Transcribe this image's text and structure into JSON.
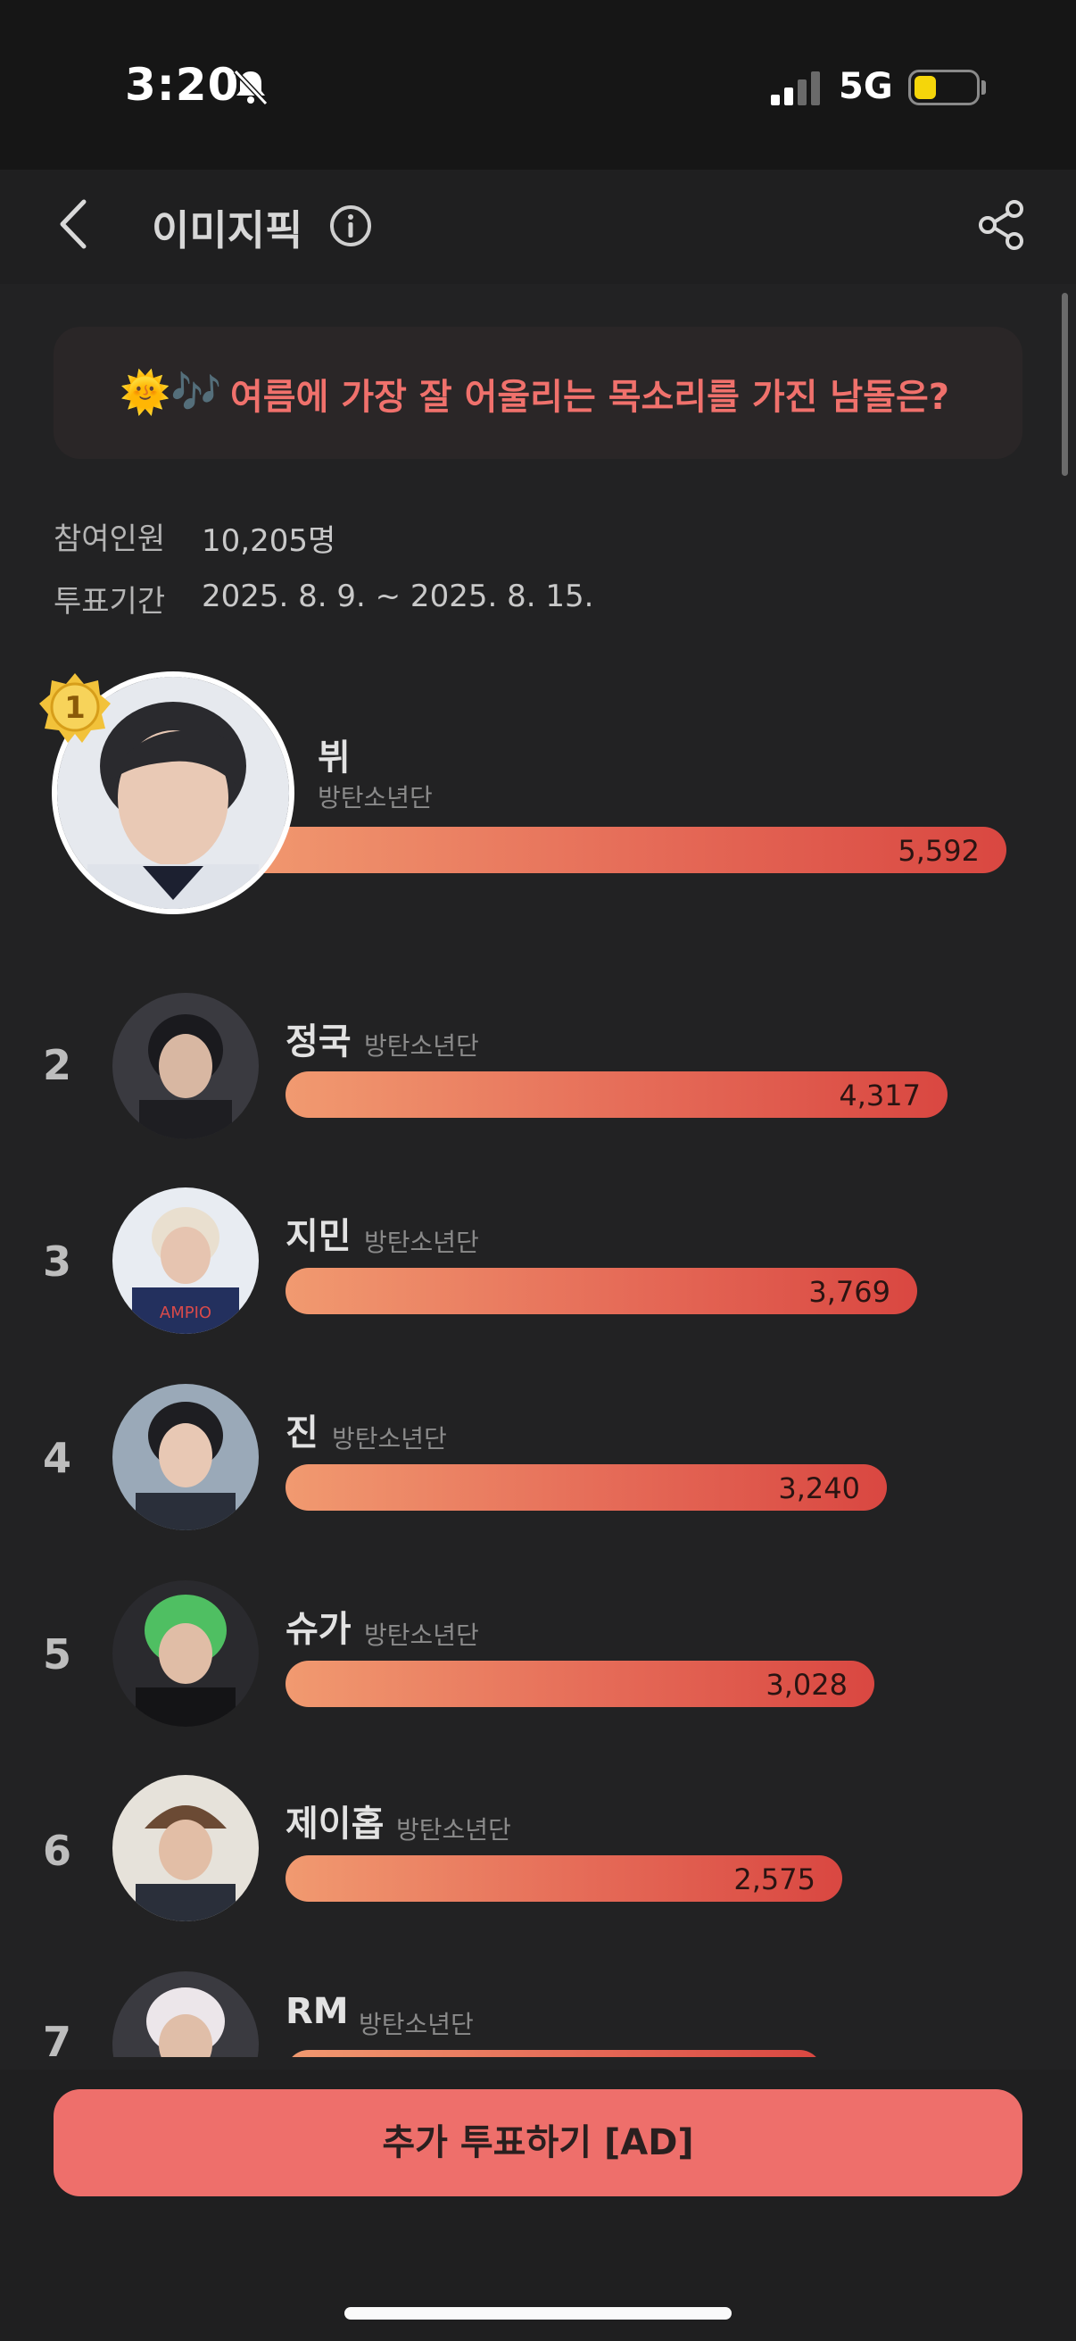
{
  "status_bar": {
    "time": "3:20",
    "network": "5G",
    "battery_level": 0.35
  },
  "nav": {
    "title": "이미지픽",
    "icons": [
      "chevron-left-icon",
      "info-icon",
      "share-icon"
    ]
  },
  "question": {
    "emoji": "🌞🎶",
    "text": "여름에 가장 잘 어울리는 목소리를 가진 남돌은?"
  },
  "meta": {
    "participants_label": "참여인원",
    "participants_value": "10,205명",
    "period_label": "투표기간",
    "period_value": "2025. 8. 9. ~ 2025. 8. 15."
  },
  "rankings": [
    {
      "rank": "1",
      "name": "뷔",
      "group": "방탄소년단",
      "votes": "5,592",
      "avatar_color": "#9ea8b6"
    },
    {
      "rank": "2",
      "name": "정국",
      "group": "방탄소년단",
      "votes": "4,317",
      "avatar_color": "#4a4a50"
    },
    {
      "rank": "3",
      "name": "지민",
      "group": "방탄소년단",
      "votes": "3,769",
      "avatar_color": "#2c3560"
    },
    {
      "rank": "4",
      "name": "진",
      "group": "방탄소년단",
      "votes": "3,240",
      "avatar_color": "#8c9bab"
    },
    {
      "rank": "5",
      "name": "슈가",
      "group": "방탄소년단",
      "votes": "3,028",
      "avatar_color": "#3f8f4f"
    },
    {
      "rank": "6",
      "name": "제이홉",
      "group": "방탄소년단",
      "votes": "2,575",
      "avatar_color": "#c7b19a"
    },
    {
      "rank": "7",
      "name": "RM",
      "group": "방탄소년단",
      "votes": "",
      "avatar_color": "#d7cfd2"
    }
  ],
  "cta": {
    "label": "추가 투표하기 [AD]"
  },
  "colors": {
    "accent": "#ee6f6b",
    "question_text": "#f0716c",
    "bar_start": "#f19a70",
    "bar_end": "#d94741"
  }
}
